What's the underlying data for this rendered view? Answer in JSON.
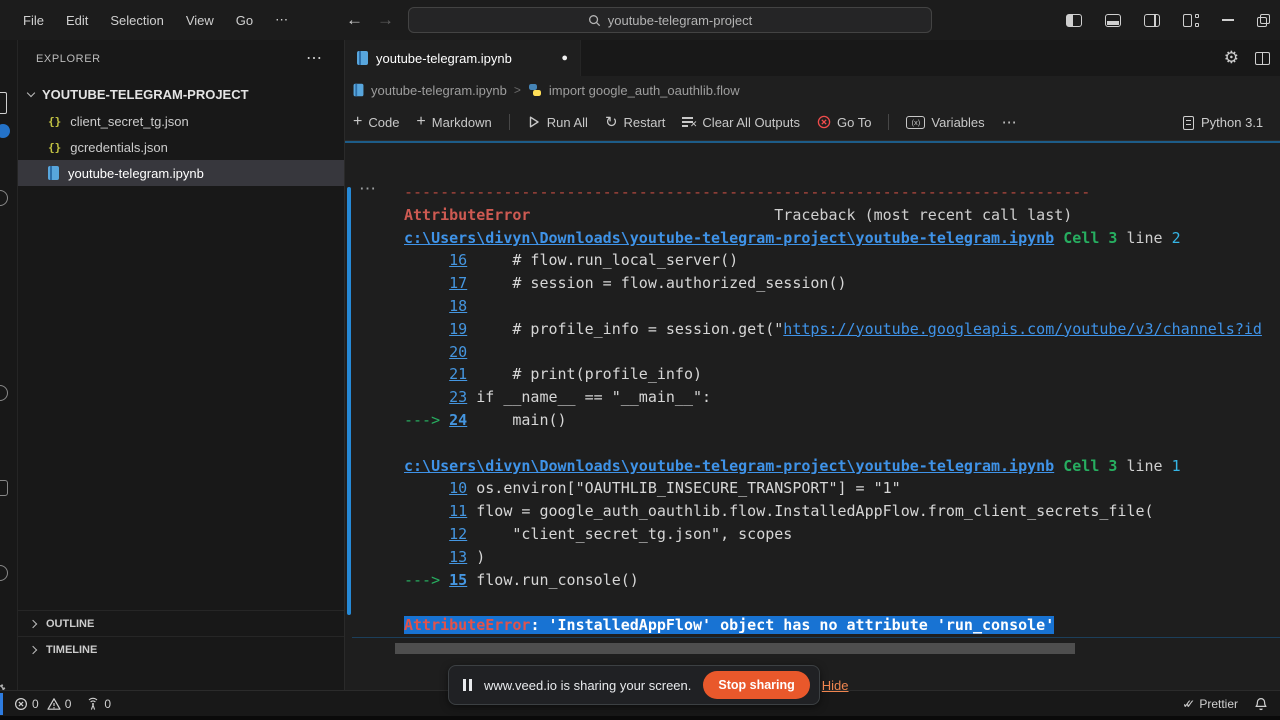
{
  "titlebar": {
    "menus": [
      "File",
      "Edit",
      "Selection",
      "View",
      "Go"
    ],
    "search_value": "youtube-telegram-project"
  },
  "icons": {
    "ellipsis": "⋯",
    "plus": "+",
    "restart": "↻",
    "back_arrow": "←",
    "forward_arrow": "→",
    "dirty_dot": "●",
    "gear": "⚙",
    "json_braces": "{}",
    "variables_box_label": "(x)",
    "check": "✓",
    "clear_x": "✕"
  },
  "sidebar": {
    "header": "EXPLORER",
    "root_folder": "YOUTUBE-TELEGRAM-PROJECT",
    "files": [
      {
        "name": "client_secret_tg.json",
        "icon": "json-icon"
      },
      {
        "name": "gcredentials.json",
        "icon": "json-icon"
      },
      {
        "name": "youtube-telegram.ipynb",
        "icon": "notebook-icon",
        "selected": true
      }
    ],
    "sections": [
      "OUTLINE",
      "TIMELINE"
    ]
  },
  "editor": {
    "tab_title": "youtube-telegram.ipynb",
    "breadcrumb": [
      "youtube-telegram.ipynb",
      "import google_auth_oauthlib.flow"
    ],
    "toolbar": {
      "code": "Code",
      "markdown": "Markdown",
      "run_all": "Run All",
      "restart": "Restart",
      "clear_all_outputs": "Clear All Outputs",
      "go_to": "Go To",
      "variables": "Variables",
      "kernel": "Python 3.1"
    }
  },
  "traceback": {
    "lines": [
      [
        [
          "r",
          "----------------------------------------------------------------------------"
        ]
      ],
      [
        [
          "e",
          "AttributeError"
        ],
        [
          "p",
          "                           Traceback (most recent call last)"
        ]
      ],
      [
        [
          "l",
          "c:\\Users\\divyn\\Downloads\\youtube-telegram-project\\youtube-telegram.ipynb"
        ],
        [
          "p",
          " "
        ],
        [
          "g",
          "Cell 3"
        ],
        [
          "p",
          " line "
        ],
        [
          "c",
          "2"
        ]
      ],
      [
        [
          "p",
          "     "
        ],
        [
          "n",
          "16"
        ],
        [
          "code",
          "     # flow.run_local_server()"
        ]
      ],
      [
        [
          "p",
          "     "
        ],
        [
          "n",
          "17"
        ],
        [
          "code",
          "     # session = flow.authorized_session()"
        ]
      ],
      [
        [
          "p",
          "     "
        ],
        [
          "n",
          "18"
        ],
        [
          "code",
          ""
        ]
      ],
      [
        [
          "p",
          "     "
        ],
        [
          "n",
          "19"
        ],
        [
          "code",
          "     # profile_info = session.get(\""
        ],
        [
          "u",
          "https://youtube.googleapis.com/youtube/v3/channels?id"
        ]
      ],
      [
        [
          "p",
          "     "
        ],
        [
          "n",
          "20"
        ],
        [
          "code",
          ""
        ]
      ],
      [
        [
          "p",
          "     "
        ],
        [
          "n",
          "21"
        ],
        [
          "code",
          "     # print(profile_info)"
        ]
      ],
      [
        [
          "p",
          "     "
        ],
        [
          "n",
          "23"
        ],
        [
          "code",
          " if __name__ == \"__main__\":"
        ]
      ],
      [
        [
          "a",
          "---> "
        ],
        [
          "nb",
          "24"
        ],
        [
          "code",
          "     main()"
        ]
      ],
      [],
      [
        [
          "l",
          "c:\\Users\\divyn\\Downloads\\youtube-telegram-project\\youtube-telegram.ipynb"
        ],
        [
          "p",
          " "
        ],
        [
          "g",
          "Cell 3"
        ],
        [
          "p",
          " line "
        ],
        [
          "c",
          "1"
        ]
      ],
      [
        [
          "p",
          "     "
        ],
        [
          "n",
          "10"
        ],
        [
          "code",
          " os.environ[\"OAUTHLIB_INSECURE_TRANSPORT\"] = \"1\""
        ]
      ],
      [
        [
          "p",
          "     "
        ],
        [
          "n",
          "11"
        ],
        [
          "code",
          " flow = google_auth_oauthlib.flow.InstalledAppFlow.from_client_secrets_file("
        ]
      ],
      [
        [
          "p",
          "     "
        ],
        [
          "n",
          "12"
        ],
        [
          "code",
          "     \"client_secret_tg.json\", scopes"
        ]
      ],
      [
        [
          "p",
          "     "
        ],
        [
          "n",
          "13"
        ],
        [
          "code",
          " )"
        ]
      ],
      [
        [
          "a",
          "---> "
        ],
        [
          "nb",
          "15"
        ],
        [
          "code",
          " flow.run_console()"
        ]
      ],
      [],
      [
        [
          "sele",
          "AttributeError"
        ],
        [
          "selw",
          ": 'InstalledAppFlow' object has no attribute 'run_console'"
        ]
      ]
    ]
  },
  "sharing": {
    "message": "www.veed.io is sharing your screen.",
    "stop_label": "Stop sharing",
    "hide_label": "Hide"
  },
  "statusbar": {
    "errors": "0",
    "warnings": "0",
    "broadcast": "0",
    "formatter": "Prettier"
  },
  "colors": {
    "selection_blue": "#1873d3",
    "error_red": "#ce5a52",
    "link_blue": "#3f93e8",
    "trace_green": "#27ae60",
    "trace_cyan": "#35b5e5",
    "focus_blue": "#2689d6",
    "stop_button_orange": "#e9582b",
    "badge_blue": "#2472c8"
  }
}
